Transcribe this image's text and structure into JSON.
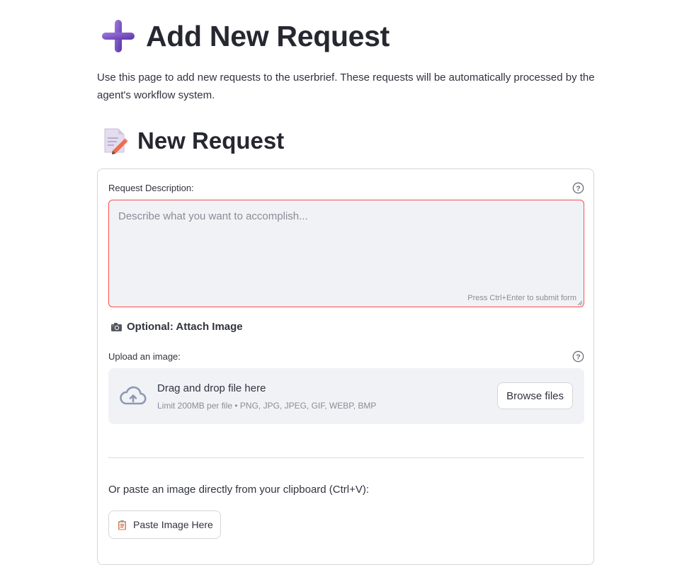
{
  "header": {
    "title": "Add New Request",
    "title_icon": "heavy-plus-icon",
    "intro": "Use this page to add new requests to the userbrief. These requests will be automatically processed by the agent's workflow system."
  },
  "section": {
    "title": "New Request",
    "title_icon": "memo-icon"
  },
  "form": {
    "description_label": "Request Description:",
    "description_placeholder": "Describe what you want to accomplish...",
    "description_value": "",
    "submit_hint": "Press Ctrl+Enter to submit form",
    "attach_heading": "Optional: Attach Image",
    "attach_icon": "camera-icon",
    "upload_label": "Upload an image:",
    "dropzone": {
      "title": "Drag and drop file here",
      "limit": "Limit 200MB per file • PNG, JPG, JPEG, GIF, WEBP, BMP",
      "browse_label": "Browse files"
    },
    "paste_caption": "Or paste an image directly from your clipboard (Ctrl+V):",
    "paste_button_label": "Paste Image Here",
    "paste_icon": "clipboard-icon"
  },
  "colors": {
    "accent_error_border": "#ff4b4b",
    "input_background": "#f0f2f6",
    "plus_icon": "#7b4fc4"
  }
}
